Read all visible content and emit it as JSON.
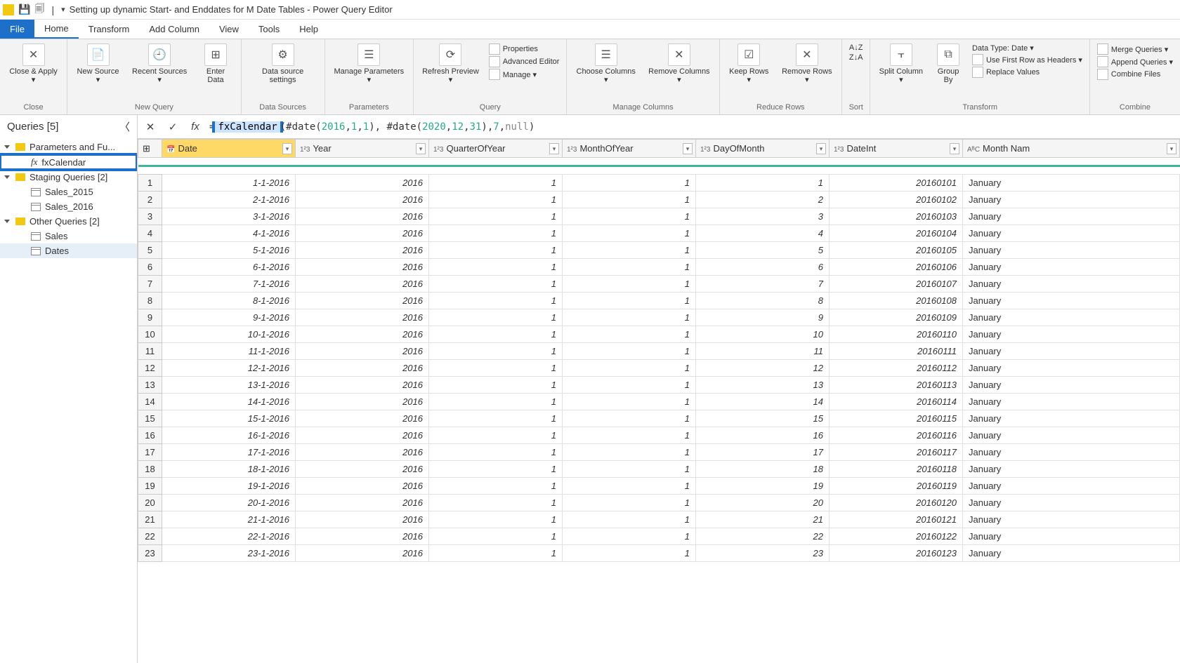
{
  "titlebar": {
    "title": "Setting up dynamic Start- and Enddates for M Date Tables - Power Query Editor"
  },
  "menu": {
    "file": "File",
    "tabs": [
      "Home",
      "Transform",
      "Add Column",
      "View",
      "Tools",
      "Help"
    ],
    "active": "Home"
  },
  "ribbon": {
    "close": {
      "btn": "Close &\nApply ▾",
      "label": "Close"
    },
    "newquery": {
      "new": "New\nSource ▾",
      "recent": "Recent\nSources ▾",
      "enter": "Enter\nData",
      "label": "New Query"
    },
    "datasources": {
      "btn": "Data source\nsettings",
      "label": "Data Sources"
    },
    "parameters": {
      "btn": "Manage\nParameters ▾",
      "label": "Parameters"
    },
    "query": {
      "refresh": "Refresh\nPreview ▾",
      "props": "Properties",
      "adv": "Advanced Editor",
      "manage": "Manage ▾",
      "label": "Query"
    },
    "managecols": {
      "choose": "Choose\nColumns ▾",
      "remove": "Remove\nColumns ▾",
      "label": "Manage Columns"
    },
    "reducerows": {
      "keep": "Keep\nRows ▾",
      "remove": "Remove\nRows ▾",
      "label": "Reduce Rows"
    },
    "sort": {
      "label": "Sort"
    },
    "transform": {
      "split": "Split\nColumn ▾",
      "group": "Group\nBy",
      "dtype": "Data Type: Date ▾",
      "first": "Use First Row as Headers ▾",
      "replace": "Replace Values",
      "label": "Transform"
    },
    "combine": {
      "merge": "Merge Queries ▾",
      "append": "Append Queries ▾",
      "combine": "Combine Files",
      "label": "Combine"
    }
  },
  "queries": {
    "title": "Queries [5]",
    "groups": [
      {
        "name": "Parameters and Fu...",
        "items": [
          {
            "name": "fxCalendar",
            "icon": "fx",
            "highlight": true
          }
        ]
      },
      {
        "name": "Staging Queries [2]",
        "items": [
          {
            "name": "Sales_2015",
            "icon": "tbl"
          },
          {
            "name": "Sales_2016",
            "icon": "tbl"
          }
        ]
      },
      {
        "name": "Other Queries [2]",
        "items": [
          {
            "name": "Sales",
            "icon": "tbl"
          },
          {
            "name": "Dates",
            "icon": "tbl",
            "selected": true
          }
        ]
      }
    ]
  },
  "formula": {
    "func": "fxCalendar",
    "rest_parts": [
      "(#date( ",
      "2016",
      ", ",
      "1",
      ", ",
      "1",
      "), #date( ",
      "2020",
      ", ",
      "12",
      ", ",
      "31",
      "), ",
      "7",
      ", ",
      "null",
      ")"
    ]
  },
  "columns": [
    {
      "name": "Date",
      "type": "date",
      "selected": true,
      "icon": "📅"
    },
    {
      "name": "Year",
      "type": "num",
      "icon": "1²3"
    },
    {
      "name": "QuarterOfYear",
      "type": "num",
      "icon": "1²3"
    },
    {
      "name": "MonthOfYear",
      "type": "num",
      "icon": "1²3"
    },
    {
      "name": "DayOfMonth",
      "type": "num",
      "icon": "1²3"
    },
    {
      "name": "DateInt",
      "type": "num",
      "icon": "1²3"
    },
    {
      "name": "Month Nam",
      "type": "txt",
      "icon": "AᴮC"
    }
  ],
  "rows": [
    {
      "Date": "1-1-2016",
      "Year": 2016,
      "QuarterOfYear": 1,
      "MonthOfYear": 1,
      "DayOfMonth": 1,
      "DateInt": 20160101,
      "Month Nam": "January"
    },
    {
      "Date": "2-1-2016",
      "Year": 2016,
      "QuarterOfYear": 1,
      "MonthOfYear": 1,
      "DayOfMonth": 2,
      "DateInt": 20160102,
      "Month Nam": "January"
    },
    {
      "Date": "3-1-2016",
      "Year": 2016,
      "QuarterOfYear": 1,
      "MonthOfYear": 1,
      "DayOfMonth": 3,
      "DateInt": 20160103,
      "Month Nam": "January"
    },
    {
      "Date": "4-1-2016",
      "Year": 2016,
      "QuarterOfYear": 1,
      "MonthOfYear": 1,
      "DayOfMonth": 4,
      "DateInt": 20160104,
      "Month Nam": "January"
    },
    {
      "Date": "5-1-2016",
      "Year": 2016,
      "QuarterOfYear": 1,
      "MonthOfYear": 1,
      "DayOfMonth": 5,
      "DateInt": 20160105,
      "Month Nam": "January"
    },
    {
      "Date": "6-1-2016",
      "Year": 2016,
      "QuarterOfYear": 1,
      "MonthOfYear": 1,
      "DayOfMonth": 6,
      "DateInt": 20160106,
      "Month Nam": "January"
    },
    {
      "Date": "7-1-2016",
      "Year": 2016,
      "QuarterOfYear": 1,
      "MonthOfYear": 1,
      "DayOfMonth": 7,
      "DateInt": 20160107,
      "Month Nam": "January"
    },
    {
      "Date": "8-1-2016",
      "Year": 2016,
      "QuarterOfYear": 1,
      "MonthOfYear": 1,
      "DayOfMonth": 8,
      "DateInt": 20160108,
      "Month Nam": "January"
    },
    {
      "Date": "9-1-2016",
      "Year": 2016,
      "QuarterOfYear": 1,
      "MonthOfYear": 1,
      "DayOfMonth": 9,
      "DateInt": 20160109,
      "Month Nam": "January"
    },
    {
      "Date": "10-1-2016",
      "Year": 2016,
      "QuarterOfYear": 1,
      "MonthOfYear": 1,
      "DayOfMonth": 10,
      "DateInt": 20160110,
      "Month Nam": "January"
    },
    {
      "Date": "11-1-2016",
      "Year": 2016,
      "QuarterOfYear": 1,
      "MonthOfYear": 1,
      "DayOfMonth": 11,
      "DateInt": 20160111,
      "Month Nam": "January"
    },
    {
      "Date": "12-1-2016",
      "Year": 2016,
      "QuarterOfYear": 1,
      "MonthOfYear": 1,
      "DayOfMonth": 12,
      "DateInt": 20160112,
      "Month Nam": "January"
    },
    {
      "Date": "13-1-2016",
      "Year": 2016,
      "QuarterOfYear": 1,
      "MonthOfYear": 1,
      "DayOfMonth": 13,
      "DateInt": 20160113,
      "Month Nam": "January"
    },
    {
      "Date": "14-1-2016",
      "Year": 2016,
      "QuarterOfYear": 1,
      "MonthOfYear": 1,
      "DayOfMonth": 14,
      "DateInt": 20160114,
      "Month Nam": "January"
    },
    {
      "Date": "15-1-2016",
      "Year": 2016,
      "QuarterOfYear": 1,
      "MonthOfYear": 1,
      "DayOfMonth": 15,
      "DateInt": 20160115,
      "Month Nam": "January"
    },
    {
      "Date": "16-1-2016",
      "Year": 2016,
      "QuarterOfYear": 1,
      "MonthOfYear": 1,
      "DayOfMonth": 16,
      "DateInt": 20160116,
      "Month Nam": "January"
    },
    {
      "Date": "17-1-2016",
      "Year": 2016,
      "QuarterOfYear": 1,
      "MonthOfYear": 1,
      "DayOfMonth": 17,
      "DateInt": 20160117,
      "Month Nam": "January"
    },
    {
      "Date": "18-1-2016",
      "Year": 2016,
      "QuarterOfYear": 1,
      "MonthOfYear": 1,
      "DayOfMonth": 18,
      "DateInt": 20160118,
      "Month Nam": "January"
    },
    {
      "Date": "19-1-2016",
      "Year": 2016,
      "QuarterOfYear": 1,
      "MonthOfYear": 1,
      "DayOfMonth": 19,
      "DateInt": 20160119,
      "Month Nam": "January"
    },
    {
      "Date": "20-1-2016",
      "Year": 2016,
      "QuarterOfYear": 1,
      "MonthOfYear": 1,
      "DayOfMonth": 20,
      "DateInt": 20160120,
      "Month Nam": "January"
    },
    {
      "Date": "21-1-2016",
      "Year": 2016,
      "QuarterOfYear": 1,
      "MonthOfYear": 1,
      "DayOfMonth": 21,
      "DateInt": 20160121,
      "Month Nam": "January"
    },
    {
      "Date": "22-1-2016",
      "Year": 2016,
      "QuarterOfYear": 1,
      "MonthOfYear": 1,
      "DayOfMonth": 22,
      "DateInt": 20160122,
      "Month Nam": "January"
    },
    {
      "Date": "23-1-2016",
      "Year": 2016,
      "QuarterOfYear": 1,
      "MonthOfYear": 1,
      "DayOfMonth": 23,
      "DateInt": 20160123,
      "Month Nam": "January"
    }
  ]
}
